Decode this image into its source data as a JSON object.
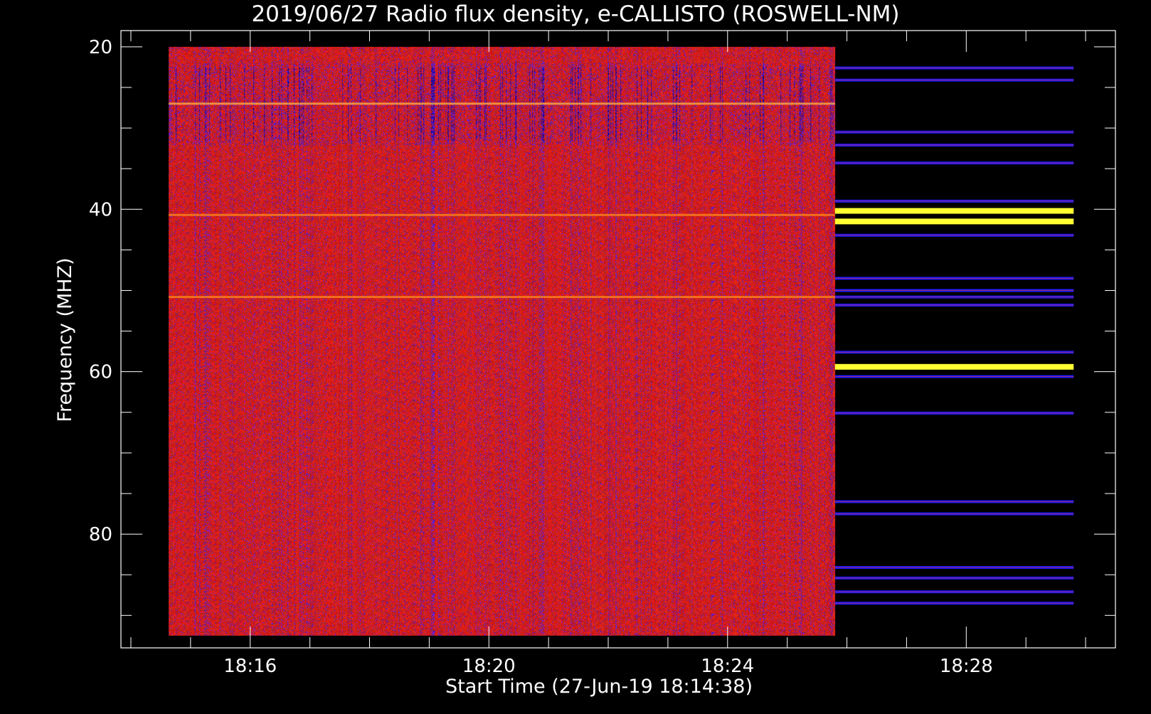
{
  "chart_data": {
    "type": "heatmap",
    "title": "2019/06/27  Radio flux density, e-CALLISTO (ROSWELL-NM)",
    "xlabel": "Start Time (27-Jun-19 18:14:38)",
    "ylabel": "Frequency (MHZ)",
    "x_tick_labels": [
      "18:16",
      "18:20",
      "18:24",
      "18:28"
    ],
    "y_tick_labels": [
      "20",
      "40",
      "60",
      "80"
    ],
    "y_range_mhz": [
      18.0,
      94.0
    ],
    "y_inverted": true,
    "data_time_span": [
      "18:14:38",
      "18:29:48"
    ],
    "dense_spectrogram_until": "18:25:48",
    "colormap": [
      "#000000",
      "#0000ff",
      "#ff0000",
      "#ffff00"
    ],
    "strong_bands_mhz": [
      27.0,
      40.7,
      50.8
    ],
    "late_band_segments_mhz": [
      22.6,
      24.1,
      30.5,
      32.1,
      34.3,
      39.0,
      40.2,
      41.5,
      43.2,
      48.5,
      50.0,
      50.8,
      51.8,
      57.6,
      59.4,
      60.6,
      65.1,
      76.0,
      77.5,
      84.1,
      85.4,
      87.1,
      88.5
    ],
    "late_yellow_bands_mhz": [
      40.2,
      41.5,
      59.4
    ]
  }
}
